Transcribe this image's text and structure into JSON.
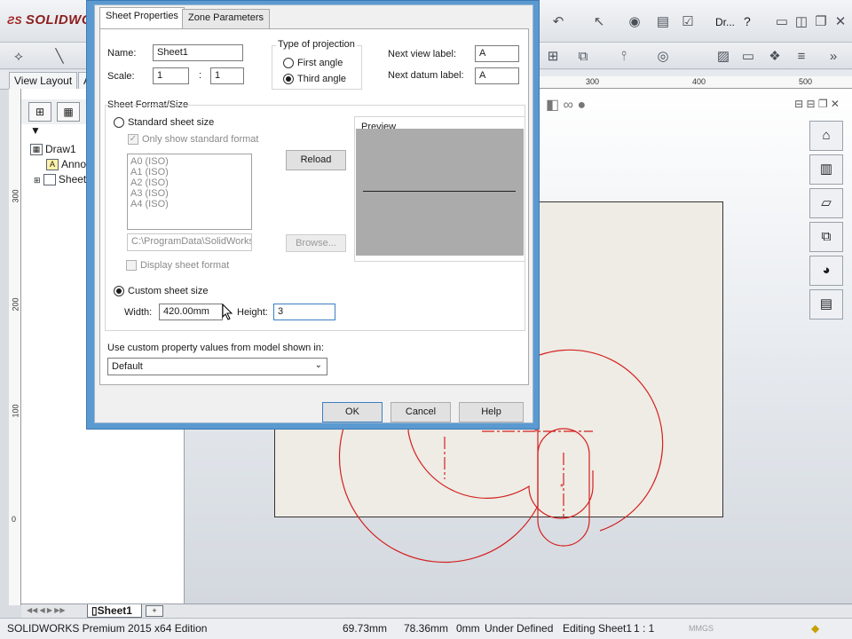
{
  "app": {
    "logo": "SOLIDWORKS",
    "doc_short": "Dr...",
    "help_icon": "?"
  },
  "command_tabs": [
    "View Layout",
    "A"
  ],
  "ruler_top": [
    "300",
    "400",
    "500"
  ],
  "ruler_left": [
    "300",
    "200",
    "100",
    "0"
  ],
  "feature_tree": {
    "root": "Draw1",
    "items": [
      "Anno",
      "Sheet"
    ]
  },
  "sheet_tab": "Sheet1",
  "status_bar": {
    "edition": "SOLIDWORKS Premium 2015 x64 Edition",
    "x": "69.73mm",
    "y": "78.36mm",
    "z": "0mm",
    "state": "Under Defined",
    "editing": "Editing Sheet1",
    "scale": "1 : 1",
    "units": "MMGS"
  },
  "dialog": {
    "tabs": [
      "Sheet Properties",
      "Zone Parameters"
    ],
    "name_label": "Name:",
    "name_value": "Sheet1",
    "scale_label": "Scale:",
    "scale_num": "1",
    "scale_sep": ":",
    "scale_den": "1",
    "projection": {
      "title": "Type of projection",
      "first": "First angle",
      "third": "Third angle",
      "selected": "third"
    },
    "next_view_label": "Next view label:",
    "next_view_value": "A",
    "next_datum_label": "Next datum label:",
    "next_datum_value": "A",
    "format_group": "Sheet Format/Size",
    "standard_size": "Standard sheet size",
    "only_standard": "Only show standard format",
    "sizes": [
      "A0 (ISO)",
      "A1 (ISO)",
      "A2 (ISO)",
      "A3 (ISO)",
      "A4 (ISO)"
    ],
    "reload": "Reload",
    "preview": "Preview",
    "path": "C:\\ProgramData\\SolidWorks",
    "browse": "Browse...",
    "display_format": "Display sheet format",
    "custom_size": "Custom sheet size",
    "size_selected": "custom",
    "width_label": "Width:",
    "width_value": "420.00mm",
    "height_label": "Height:",
    "height_value": "3",
    "custom_prop_label": "Use custom property values from model shown in:",
    "custom_prop_value": "Default",
    "ok": "OK",
    "cancel": "Cancel",
    "help": "Help"
  },
  "colors": {
    "dialog_frame": "#5b9ad0",
    "sketch": "#d42020",
    "sheet": "#eeece4"
  }
}
